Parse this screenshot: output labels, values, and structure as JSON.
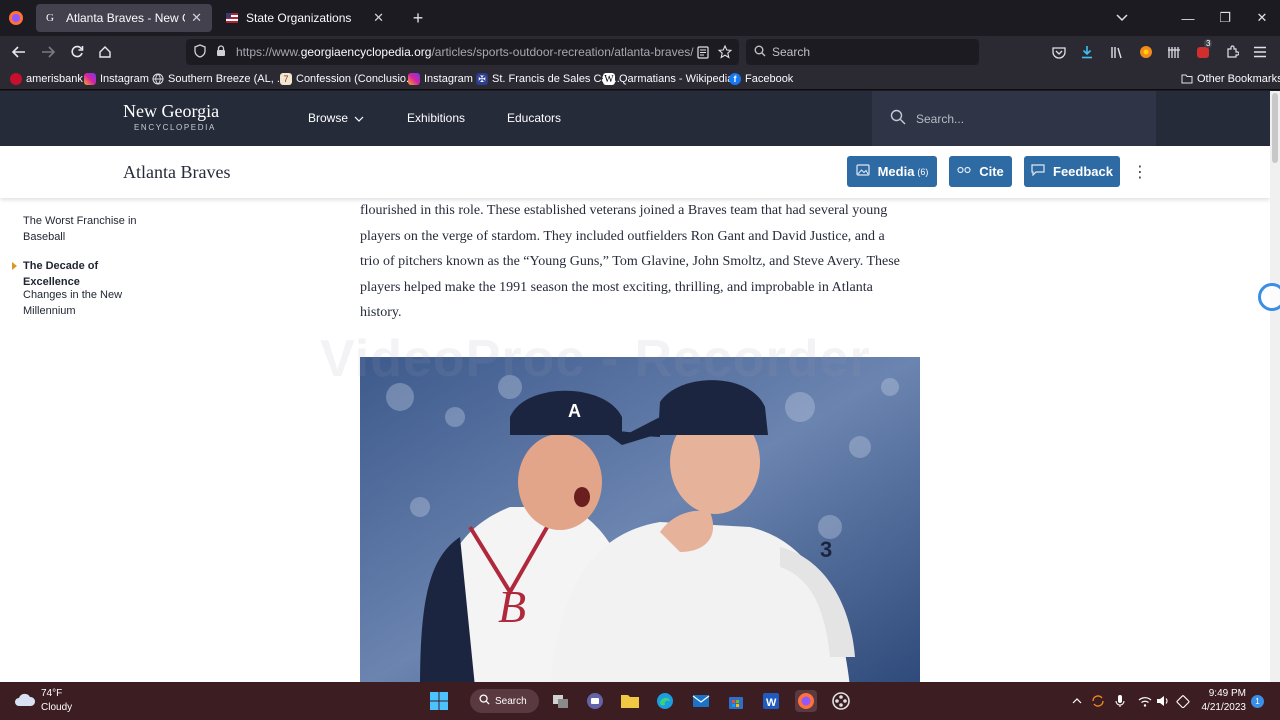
{
  "tabs": [
    {
      "title": "Atlanta Braves - New Georgia Er",
      "favicon": "G"
    },
    {
      "title": "State Organizations"
    }
  ],
  "window_controls": {
    "minimize": "—",
    "maximize": "❐",
    "close": "✕",
    "new_tab": "+",
    "tab_list": "⌄"
  },
  "address_bar": {
    "url_prefix": "https://www.",
    "url_host": "georgiaencyclopedia.org",
    "url_path": "/articles/sports-outdoor-recreation/atlanta-braves/"
  },
  "search_bar": {
    "placeholder": "Search"
  },
  "toolbar_badges": {
    "extensions_count": "3"
  },
  "bookmarks": [
    {
      "label": "amerisbank",
      "icon": "ameris-icon",
      "color": "#c8102e"
    },
    {
      "label": "Instagram",
      "icon": "instagram-icon",
      "color": "#d6249f"
    },
    {
      "label": "Southern Breeze (AL, ...",
      "icon": "globe-icon",
      "color": "#555555"
    },
    {
      "label": "Confession (Conclusio...",
      "icon": "confession-icon",
      "color": "#7a5c2e"
    },
    {
      "label": "Instagram",
      "icon": "instagram-icon",
      "color": "#d6249f"
    },
    {
      "label": "St. Francis de Sales Cat...",
      "icon": "cross-icon",
      "color": "#2a3d8f"
    },
    {
      "label": "Qarmatians - Wikipedia",
      "icon": "wikipedia-icon",
      "color": "#ffffff"
    },
    {
      "label": "Facebook",
      "icon": "facebook-icon",
      "color": "#1877f2"
    }
  ],
  "other_bookmarks": "Other Bookmarks",
  "site": {
    "logo_title": "New Georgia",
    "logo_sub": "ENCYCLOPEDIA",
    "nav": [
      {
        "label": "Browse"
      },
      {
        "label": "Exhibitions"
      },
      {
        "label": "Educators"
      }
    ],
    "search_placeholder": "Search..."
  },
  "article": {
    "title": "Atlanta Braves",
    "buttons": {
      "media": "Media",
      "media_count": "(6)",
      "cite": "Cite",
      "feedback": "Feedback"
    },
    "toc": [
      {
        "label": "The Worst Franchise in Baseball",
        "current": false
      },
      {
        "label": "The Decade of Excellence",
        "current": true
      },
      {
        "label": "Changes in the New Millennium",
        "current": false
      }
    ],
    "paragraph": "flourished in this role. These established veterans joined a Braves team that had several young players on the verge of stardom. They included outfielders Ron Gant and David Justice, and a trio of pitchers known as the “Young Guns,” Tom Glavine, John Smoltz, and Steve Avery. These players helped make the 1991 season the most exciting, thrilling, and improbable in Atlanta history."
  },
  "watermark": "VideoProc - Recorder",
  "taskbar": {
    "weather_temp": "74°F",
    "weather_condition": "Cloudy",
    "search_label": "Search",
    "time": "9:49 PM",
    "date": "4/21/2023",
    "notification_count": "1"
  },
  "colors": {
    "site_header": "#262b3a",
    "button_blue": "#2e6aa3",
    "toc_marker": "#d89a1c",
    "taskbar": "#3b1d22"
  }
}
